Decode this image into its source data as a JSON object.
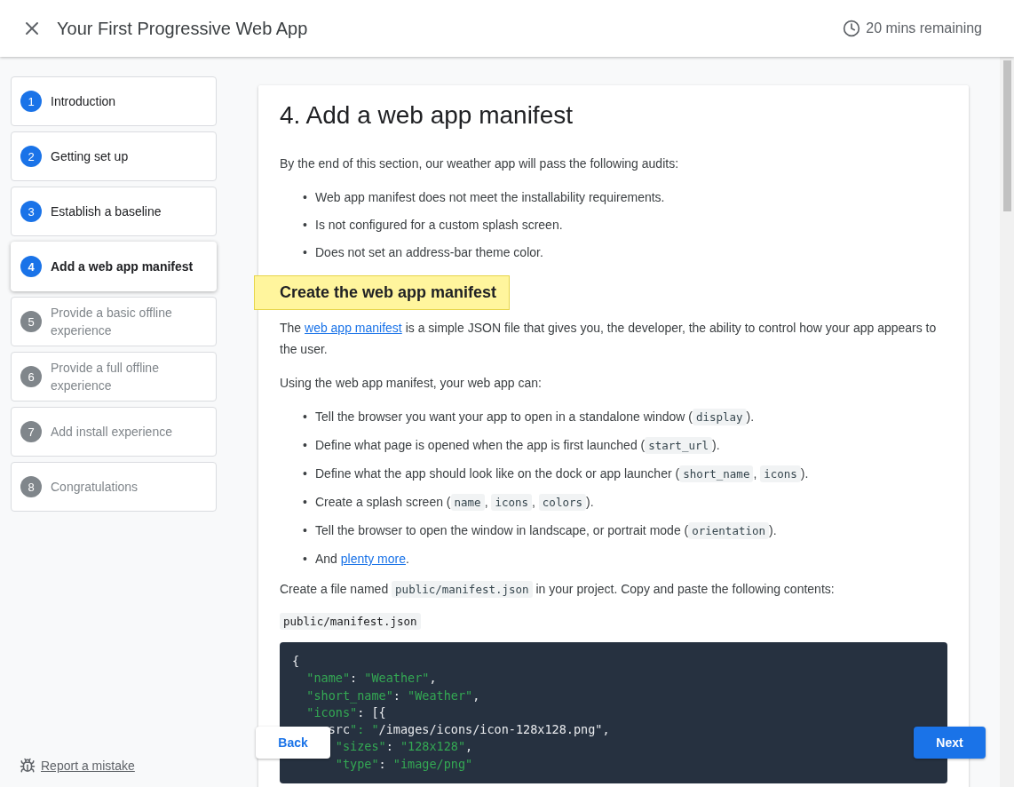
{
  "header": {
    "title": "Your First Progressive Web App",
    "time_remaining": "20 mins remaining"
  },
  "steps": [
    {
      "number": "1",
      "label": "Introduction",
      "visited": true,
      "selected": false
    },
    {
      "number": "2",
      "label": "Getting set up",
      "visited": true,
      "selected": false
    },
    {
      "number": "3",
      "label": "Establish a baseline",
      "visited": true,
      "selected": false
    },
    {
      "number": "4",
      "label": "Add a web app manifest",
      "visited": true,
      "selected": true
    },
    {
      "number": "5",
      "label": "Provide a basic offline experience",
      "visited": false,
      "selected": false
    },
    {
      "number": "6",
      "label": "Provide a full offline experience",
      "visited": false,
      "selected": false
    },
    {
      "number": "7",
      "label": "Add install experience",
      "visited": false,
      "selected": false
    },
    {
      "number": "8",
      "label": "Congratulations",
      "visited": false,
      "selected": false
    }
  ],
  "article": {
    "title": "4. Add a web app manifest",
    "blocks": [
      {
        "kind": "paragraph",
        "segments": [
          {
            "kind": "text",
            "text": "By the end of this section, our weather app will pass the following audits:"
          }
        ]
      },
      {
        "kind": "list",
        "marker": "•",
        "items": [
          [
            {
              "kind": "text",
              "text": "Web app manifest does not meet the installability requirements."
            }
          ],
          [
            {
              "kind": "text",
              "text": "Is not configured for a custom splash screen."
            }
          ],
          [
            {
              "kind": "text",
              "text": "Does not set an address-bar theme color."
            }
          ]
        ]
      },
      {
        "kind": "heading",
        "text": "Create the web app manifest",
        "highlighted": true
      },
      {
        "kind": "paragraph",
        "segments": [
          {
            "kind": "text",
            "text": "The "
          },
          {
            "kind": "link",
            "text": "web app manifest"
          },
          {
            "kind": "text",
            "text": " is a simple JSON file that gives you, the developer, the ability to control how your app appears to the user."
          }
        ]
      },
      {
        "kind": "paragraph",
        "segments": [
          {
            "kind": "text",
            "text": "Using the web app manifest, your web app can:"
          }
        ]
      },
      {
        "kind": "list",
        "marker": "•",
        "items": [
          [
            {
              "kind": "text",
              "text": "Tell the browser you want your app to open in a standalone window ("
            },
            {
              "kind": "code",
              "text": "display"
            },
            {
              "kind": "text",
              "text": ")."
            }
          ],
          [
            {
              "kind": "text",
              "text": "Define what page is opened when the app is first launched ("
            },
            {
              "kind": "code",
              "text": "start_url"
            },
            {
              "kind": "text",
              "text": ")."
            }
          ],
          [
            {
              "kind": "text",
              "text": "Define what the app should look like on the dock or app launcher ("
            },
            {
              "kind": "code",
              "text": "short_name"
            },
            {
              "kind": "text",
              "text": ", "
            },
            {
              "kind": "code",
              "text": "icons"
            },
            {
              "kind": "text",
              "text": ")."
            }
          ],
          [
            {
              "kind": "text",
              "text": "Create a splash screen ("
            },
            {
              "kind": "code",
              "text": "name"
            },
            {
              "kind": "text",
              "text": ", "
            },
            {
              "kind": "code",
              "text": "icons"
            },
            {
              "kind": "text",
              "text": ", "
            },
            {
              "kind": "code",
              "text": "colors"
            },
            {
              "kind": "text",
              "text": ")."
            }
          ],
          [
            {
              "kind": "text",
              "text": "Tell the browser to open the window in landscape, or portrait mode ("
            },
            {
              "kind": "code",
              "text": "orientation"
            },
            {
              "kind": "text",
              "text": ")."
            }
          ],
          [
            {
              "kind": "text",
              "text": "And "
            },
            {
              "kind": "link",
              "text": "plenty more"
            },
            {
              "kind": "text",
              "text": "."
            }
          ]
        ]
      },
      {
        "kind": "paragraph",
        "segments": [
          {
            "kind": "text",
            "text": "Create a file named "
          },
          {
            "kind": "code",
            "text": "public/manifest.json"
          },
          {
            "kind": "text",
            "text": " in your project. Copy and paste the following contents:"
          }
        ]
      },
      {
        "kind": "file_label",
        "text": "public/manifest.json"
      },
      {
        "kind": "code_block",
        "lines": [
          "{",
          "  \"name\": \"Weather\",",
          "  \"short_name\": \"Weather\",",
          "  \"icons\": [{",
          "     src\": \"/images/icons/icon-128x128.png\",",
          "      \"sizes\": \"128x128\",",
          "      \"type\": \"image/png\""
        ]
      }
    ]
  },
  "navigation": {
    "back": "Back",
    "next": "Next"
  },
  "report_link": "Report a mistake"
}
